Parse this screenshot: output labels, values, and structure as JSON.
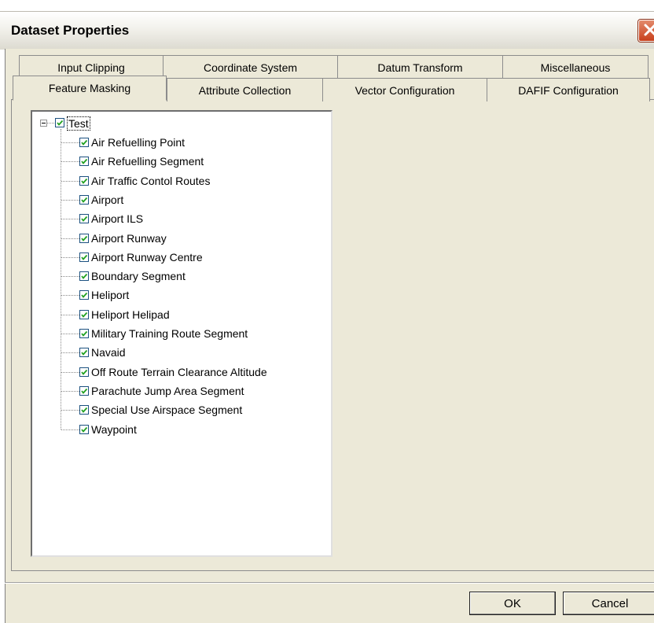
{
  "window": {
    "title": "Dataset Properties",
    "close_icon": "close-icon"
  },
  "tabs_row1": [
    {
      "label": "Input Clipping"
    },
    {
      "label": "Coordinate System"
    },
    {
      "label": "Datum Transform"
    },
    {
      "label": "Miscellaneous"
    }
  ],
  "tabs_row2": [
    {
      "label": "Feature Masking",
      "active": true
    },
    {
      "label": "Attribute Collection"
    },
    {
      "label": "Vector Configuration"
    },
    {
      "label": "DAFIF Configuration"
    }
  ],
  "tree": {
    "root": {
      "label": "Test",
      "checked": true,
      "expanded": true
    },
    "items": [
      {
        "label": "Air Refuelling Point",
        "checked": true
      },
      {
        "label": "Air Refuelling Segment",
        "checked": true
      },
      {
        "label": "Air Traffic Contol Routes",
        "checked": true
      },
      {
        "label": "Airport",
        "checked": true
      },
      {
        "label": "Airport ILS",
        "checked": true
      },
      {
        "label": "Airport Runway",
        "checked": true
      },
      {
        "label": "Airport Runway Centre",
        "checked": true
      },
      {
        "label": "Boundary Segment",
        "checked": true
      },
      {
        "label": "Heliport",
        "checked": true
      },
      {
        "label": "Heliport Helipad",
        "checked": true
      },
      {
        "label": "Military Training Route Segment",
        "checked": true
      },
      {
        "label": "Navaid",
        "checked": true
      },
      {
        "label": "Off Route Terrain Clearance Altitude",
        "checked": true
      },
      {
        "label": "Parachute Jump Area Segment",
        "checked": true
      },
      {
        "label": "Special Use Airspace Segment",
        "checked": true
      },
      {
        "label": "Waypoint",
        "checked": true
      }
    ]
  },
  "buttons": {
    "ok": "OK",
    "cancel": "Cancel"
  }
}
